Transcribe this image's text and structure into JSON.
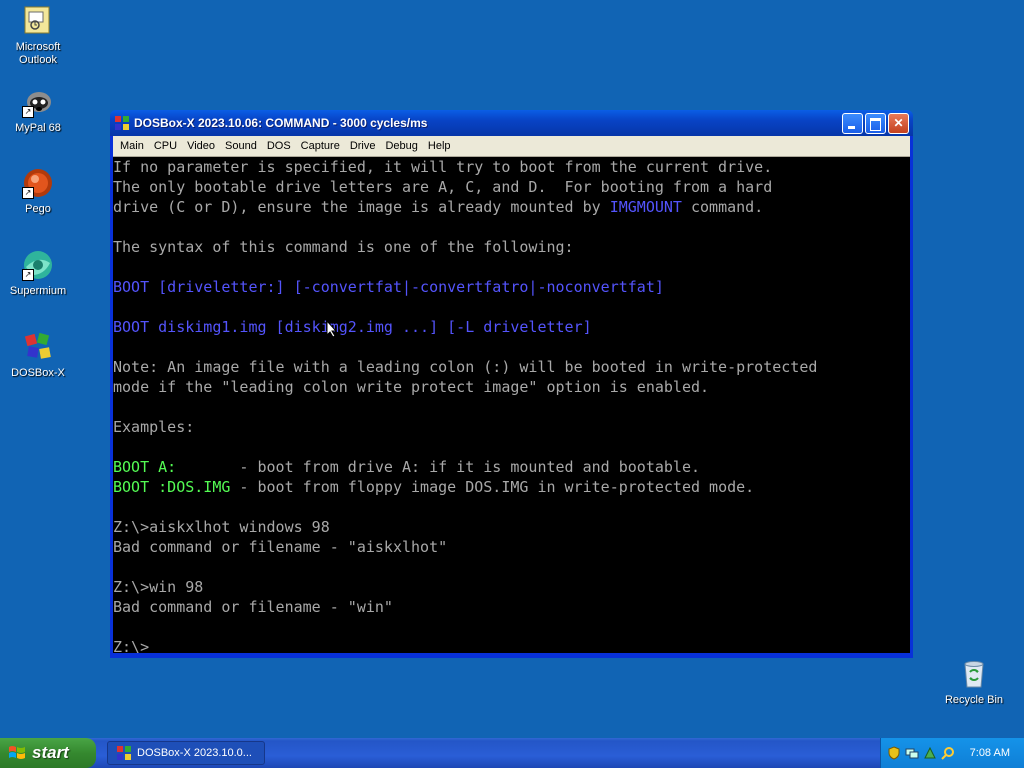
{
  "desktop": {
    "icons": [
      {
        "label": "Microsoft Outlook",
        "icon": "outlook-icon"
      },
      {
        "label": "MyPal 68",
        "icon": "mypal-icon"
      },
      {
        "label": "Pego",
        "icon": "pego-icon"
      },
      {
        "label": "Supermium",
        "icon": "supermium-icon"
      },
      {
        "label": "DOSBox-X",
        "icon": "dosbox-icon"
      }
    ],
    "recycle_bin": {
      "label": "Recycle Bin",
      "icon": "recycle-bin-icon"
    }
  },
  "window": {
    "title": "DOSBox-X 2023.10.06: COMMAND - 3000 cycles/ms",
    "menu": [
      "Main",
      "CPU",
      "Video",
      "Sound",
      "DOS",
      "Capture",
      "Drive",
      "Debug",
      "Help"
    ],
    "console": {
      "line1": "If no parameter is specified, it will try to boot from the current drive.",
      "line2": "The only bootable drive letters are A, C, and D.  For booting from a hard",
      "line3_a": "drive (C or D), ensure the image is already mounted by ",
      "line3_b": "IMGMOUNT",
      "line3_c": " command.",
      "line5": "The syntax of this command is one of the following:",
      "line7": "BOOT [driveletter:] [-convertfat|-convertfatro|-noconvertfat]",
      "line9": "BOOT diskimg1.img [diskimg2.img ...] [-L driveletter]",
      "line11": "Note: An image file with a leading colon (:) will be booted in write-protected",
      "line12": "mode if the \"leading colon write protect image\" option is enabled.",
      "line14": "Examples:",
      "line16_a": "BOOT A:",
      "line16_b": "       - boot from drive A: if it is mounted and bootable.",
      "line17_a": "BOOT :DOS.IMG",
      "line17_b": " - boot from floppy image DOS.IMG in write-protected mode.",
      "line19": "Z:\\>aiskxlhot windows 98",
      "line20": "Bad command or filename - \"aiskxlhot\"",
      "line22": "Z:\\>win 98",
      "line23": "Bad command or filename - \"win\"",
      "line25": "Z:\\>"
    }
  },
  "taskbar": {
    "start_label": "start",
    "task_label": "DOSBox-X 2023.10.0...",
    "clock": "7:08 AM"
  },
  "colors": {
    "desktop": "#1164b4",
    "console_text": "#a8a8a8",
    "console_blue": "#5454fc",
    "console_green": "#54fc54"
  }
}
